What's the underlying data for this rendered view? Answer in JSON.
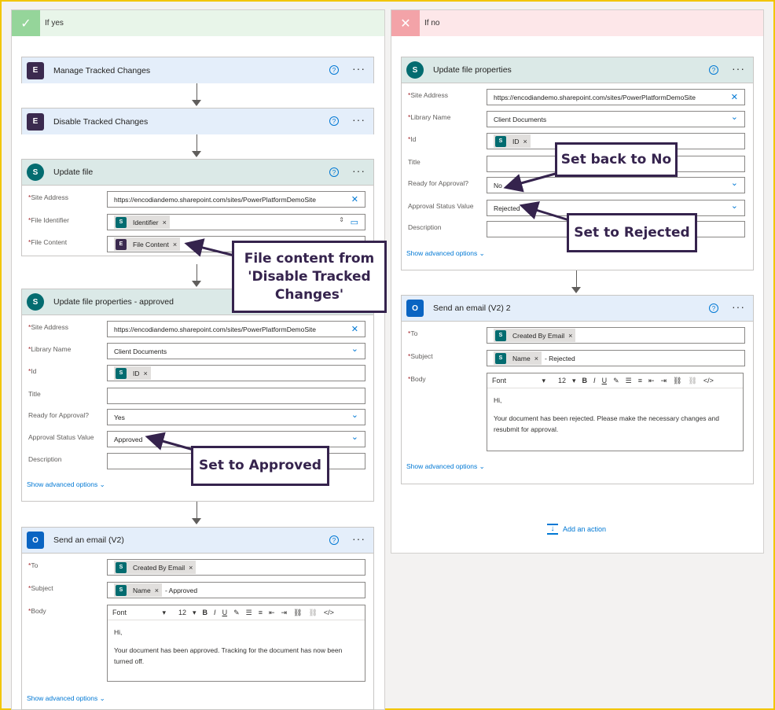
{
  "yes_branch": {
    "label": "If yes",
    "manage_tracked": {
      "title": "Manage Tracked Changes"
    },
    "disable_tracked": {
      "title": "Disable Tracked Changes"
    },
    "update_file": {
      "title": "Update file",
      "site_address_label": "Site Address",
      "site_address_value": "https://encodiandemo.sharepoint.com/sites/PowerPlatformDemoSite",
      "file_identifier_label": "File Identifier",
      "file_identifier_token": "Identifier",
      "file_content_label": "File Content",
      "file_content_token": "File Content"
    },
    "update_props": {
      "title": "Update file properties - approved",
      "site_address_label": "Site Address",
      "site_address_value": "https://encodiandemo.sharepoint.com/sites/PowerPlatformDemoSite",
      "library_label": "Library Name",
      "library_value": "Client Documents",
      "id_label": "Id",
      "id_token": "ID",
      "title_label": "Title",
      "ready_label": "Ready for Approval?",
      "ready_value": "Yes",
      "status_label": "Approval Status Value",
      "status_value": "Approved",
      "description_label": "Description",
      "advanced": "Show advanced options"
    },
    "email": {
      "title": "Send an email (V2)",
      "to_label": "To",
      "to_token": "Created By Email",
      "subject_label": "Subject",
      "subject_token": "Name",
      "subject_suffix": "- Approved",
      "body_label": "Body",
      "font": "Font",
      "size": "12",
      "body_line1": "Hi,",
      "body_line2": "Your document has been approved. Tracking for the document has now been turned off.",
      "advanced": "Show advanced options"
    }
  },
  "no_branch": {
    "label": "If no",
    "update_props": {
      "title": "Update file properties",
      "site_address_label": "Site Address",
      "site_address_value": "https://encodiandemo.sharepoint.com/sites/PowerPlatformDemoSite",
      "library_label": "Library Name",
      "library_value": "Client Documents",
      "id_label": "Id",
      "id_token": "ID",
      "title_label": "Title",
      "ready_label": "Ready for Approval?",
      "ready_value": "No",
      "status_label": "Approval Status Value",
      "status_value": "Rejected",
      "description_label": "Description",
      "advanced": "Show advanced options"
    },
    "email": {
      "title": "Send an email (V2) 2",
      "to_label": "To",
      "to_token": "Created By Email",
      "subject_label": "Subject",
      "subject_token": "Name",
      "subject_suffix": "- Rejected",
      "body_label": "Body",
      "font": "Font",
      "size": "12",
      "body_line1": "Hi,",
      "body_line2": "Your document has been rejected. Please make the necessary changes and resubmit for approval.",
      "advanced": "Show advanced options"
    },
    "add_action": "Add an action"
  },
  "callouts": {
    "file_content": "File content from 'Disable Tracked Changes'",
    "approved": "Set to Approved",
    "back_to_no": "Set back to No",
    "rejected": "Set to Rejected"
  },
  "icons": {
    "more": "···",
    "help": "?",
    "close": "✕",
    "chevron": "⌄"
  }
}
